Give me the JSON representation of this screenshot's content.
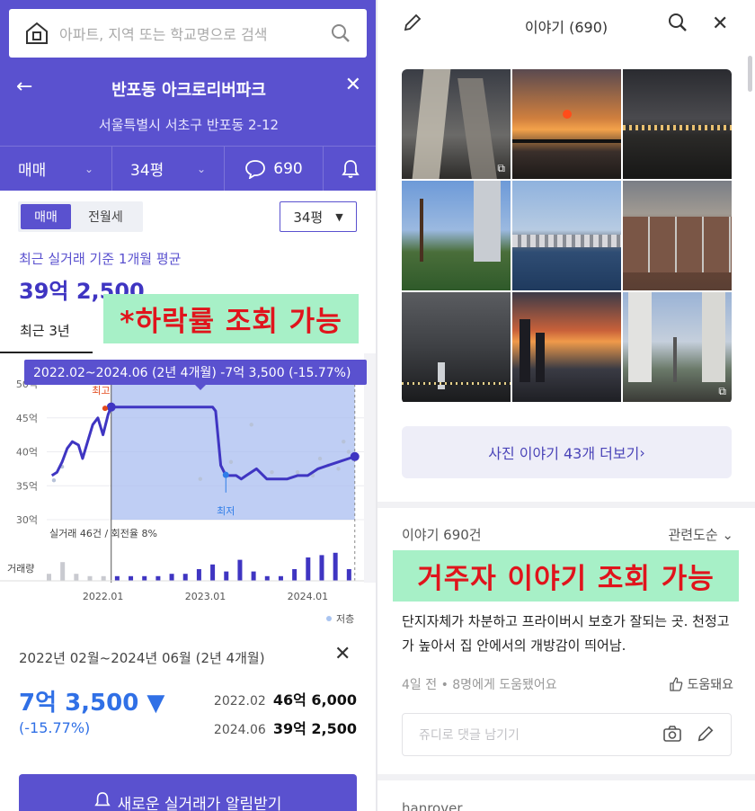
{
  "search": {
    "placeholder": "아파트, 지역 또는 학교명으로 검색"
  },
  "complex": {
    "title": "반포동 아크로리버파크",
    "address": "서울특별시 서초구 반포동 2-12"
  },
  "tabs": {
    "deal_type": "매매",
    "size": "34평",
    "comment_count": "690"
  },
  "segment": {
    "sale": "매매",
    "rent": "전월세",
    "size_select": "34평"
  },
  "summary": {
    "label": "최근 실거래 기준 1개월 평균",
    "price": "39억 2,500"
  },
  "overlay_left": "*하락률 조회 가능",
  "period_tab": "최근 3년",
  "chart_data": {
    "type": "line",
    "tooltip": "2022.02~2024.06 (2년 4개월)  -7억 3,500 (-15.77%)",
    "y_ticks": [
      "50억",
      "45억",
      "40억",
      "35억",
      "30억"
    ],
    "x_ticks": [
      "2022.01",
      "2023.01",
      "2024.01"
    ],
    "ylim": [
      30,
      50
    ],
    "max_label": "최고",
    "min_label": "최저",
    "volume_label": "거래량",
    "deal_info": "실거래 46건 / 회전율 8%",
    "legend_low": "저층",
    "series": [
      {
        "x": [
          2021.5,
          2021.55,
          2021.6,
          2021.65,
          2021.7,
          2021.76,
          2021.8,
          2021.85,
          2021.9,
          2021.95,
          2022.0,
          2022.05,
          2022.08,
          2022.12,
          2022.2,
          2022.4,
          2022.6,
          2022.8,
          2023.0,
          2023.05,
          2023.07,
          2023.1,
          2023.15,
          2023.2,
          2023.25,
          2023.3,
          2023.35,
          2023.4,
          2023.5,
          2023.6,
          2023.7,
          2023.75,
          2023.8,
          2023.9,
          2024.0,
          2024.1,
          2024.2,
          2024.3,
          2024.4,
          2024.46
        ],
        "y": [
          36.5,
          37.0,
          38.5,
          40.5,
          41.5,
          41.0,
          39.0,
          41.5,
          44.0,
          45.0,
          42.5,
          45.5,
          46.6,
          46.6,
          46.6,
          46.6,
          46.6,
          46.6,
          46.6,
          46.6,
          46.6,
          46.0,
          38.0,
          36.5,
          36.5,
          36.5,
          36.0,
          36.5,
          37.5,
          36.0,
          36.0,
          36.0,
          36.0,
          36.5,
          36.5,
          37.5,
          38.0,
          38.5,
          39.0,
          39.3
        ]
      }
    ],
    "scatter": {
      "x": [
        2021.52,
        2021.6,
        2022.95,
        2023.25,
        2023.45,
        2023.65,
        2023.9,
        2024.05,
        2024.12,
        2024.2,
        2024.3,
        2024.35,
        2024.4
      ],
      "y": [
        35.8,
        37.8,
        36.0,
        38.5,
        44.0,
        37.0,
        37.0,
        36.5,
        39.0,
        38.0,
        37.5,
        41.5,
        40.0
      ]
    },
    "volume": [
      3,
      8,
      3,
      2,
      2,
      2,
      2,
      2,
      2,
      3,
      3,
      5,
      7,
      4,
      9,
      4,
      2,
      2,
      5,
      10,
      11,
      12,
      5
    ]
  },
  "info": {
    "range": "2022년 02월~2024년 06월 (2년 4개월)",
    "change": "7억 3,500 ▼",
    "pct": "(-15.77%)",
    "from_date": "2022.02",
    "from_price": "46억 6,000",
    "to_date": "2024.06",
    "to_price": "39억 2,500"
  },
  "alert_button": "새로운 실거래가 알림받기",
  "right": {
    "title": "이야기 (690)",
    "more_photos": "사진 이야기 43개 더보기 ",
    "story_count": "이야기 690건",
    "sort": "관련도순",
    "overlay_right": "거주자 이야기 조회 가능",
    "story_text": "단지자체가 차분하고 프라이버시 보호가 잘되는 곳. 천정고가 높아서 집 안에서의 개방감이 띄어남.",
    "story_meta": "4일 전 • 8명에게 도움됐어요",
    "helpful": "도움돼요",
    "comment_placeholder": "쥬디로 댓글 남기기",
    "next_user": "hanrover"
  }
}
